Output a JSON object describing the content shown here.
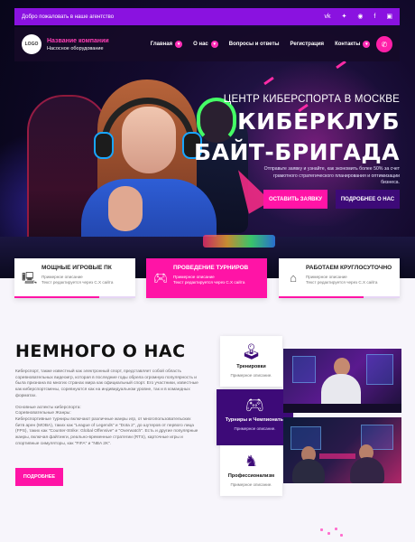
{
  "topbar": {
    "welcome": "Добро пожаловать в наше агентство",
    "socials": [
      {
        "name": "vk-icon",
        "glyph": "vk"
      },
      {
        "name": "twitter-icon",
        "glyph": "✦"
      },
      {
        "name": "ok-icon",
        "glyph": "◉"
      },
      {
        "name": "facebook-icon",
        "glyph": "f"
      },
      {
        "name": "instagram-icon",
        "glyph": "▣"
      }
    ]
  },
  "nav": {
    "logo": "LOGO",
    "brand_name": "Название компании",
    "brand_sub": "Насосное оборудование",
    "menu": [
      "Главная",
      "О нас",
      "Вопросы и ответы",
      "Регистрация",
      "Контакты"
    ],
    "phone_icon": "phone-icon"
  },
  "hero": {
    "subtitle": "ЦЕНТР КИБЕРСПОРТА В МОСКВЕ",
    "title_line1": "КИБЕРКЛУБ",
    "title_line2": "БАЙТ-БРИГАДА",
    "description": "Отправьте заявку и узнайте, как экономить более 50% за счет грамотного стратегического планирования и оптимизации бизнеса.",
    "btn_primary": "ОСТАВИТЬ ЗАЯВКУ",
    "btn_secondary": "ПОДРОБНЕЕ О НАС"
  },
  "features": [
    {
      "title": "МОЩНЫЕ ИГРОВЫЕ ПК",
      "desc1": "Примерное описание",
      "desc2": "Текст редактируется через С.Х сайта",
      "icon": "computer-icon"
    },
    {
      "title": "ПРОВЕДЕНИЕ ТУРНИРОВ",
      "desc1": "Примерное описание",
      "desc2": "Текст редактируется через С.Х сайта",
      "icon": "gamepad-icon"
    },
    {
      "title": "РАБОТАЕМ КРУГЛОСУТОЧНО",
      "desc1": "Примерное описание",
      "desc2": "Текст редактируется через С.Х сайта",
      "icon": "store-icon"
    }
  ],
  "about": {
    "title": "НЕМНОГО О НАС",
    "p1": "Киберспорт, также известный как электронный спорт, представляет собой область соревновательных видеоигр, которая в последние годы обрела огромную популярность и была признана во многих странах мира как официальный спорт. Его участники, известные как киберспортсмены, соревнуются как на индивидуальном уровне, так и в командных форматах.",
    "p2": "Основные аспекты киберспорта:",
    "p3": "Соревновательные Жанры:",
    "p4": "Киберспортивные турниры включают различные жанры игр, от многопользовательских битв арен (MOBA), таких как \"League of Legends\" и \"Dota 2\", до шутеров от первого лица (FPS), таких как \"Counter-Strike: Global Offensive\" и \"Overwatch\". Есть и другие популярные жанры, включая файтинги, реально-временные стратегии (RTS), карточные игры и спортивные симуляторы, как \"FIFA\" и \"NBA 2K\".",
    "btn_more": "ПОДРОБНЕЕ"
  },
  "services": [
    {
      "title": "Тренировки",
      "desc": "Примерное описание.",
      "icon": "arcade-icon"
    },
    {
      "title": "Турниры и Чемпионаты",
      "desc": "Примерное описание.",
      "icon": "gamepad-icon"
    },
    {
      "title": "Профессионализм",
      "desc": "Примерное описание.",
      "icon": "chess-icon"
    }
  ],
  "colors": {
    "accent": "#ff14a6",
    "purple": "#3d0a78",
    "topbar": "#8a12e0"
  }
}
